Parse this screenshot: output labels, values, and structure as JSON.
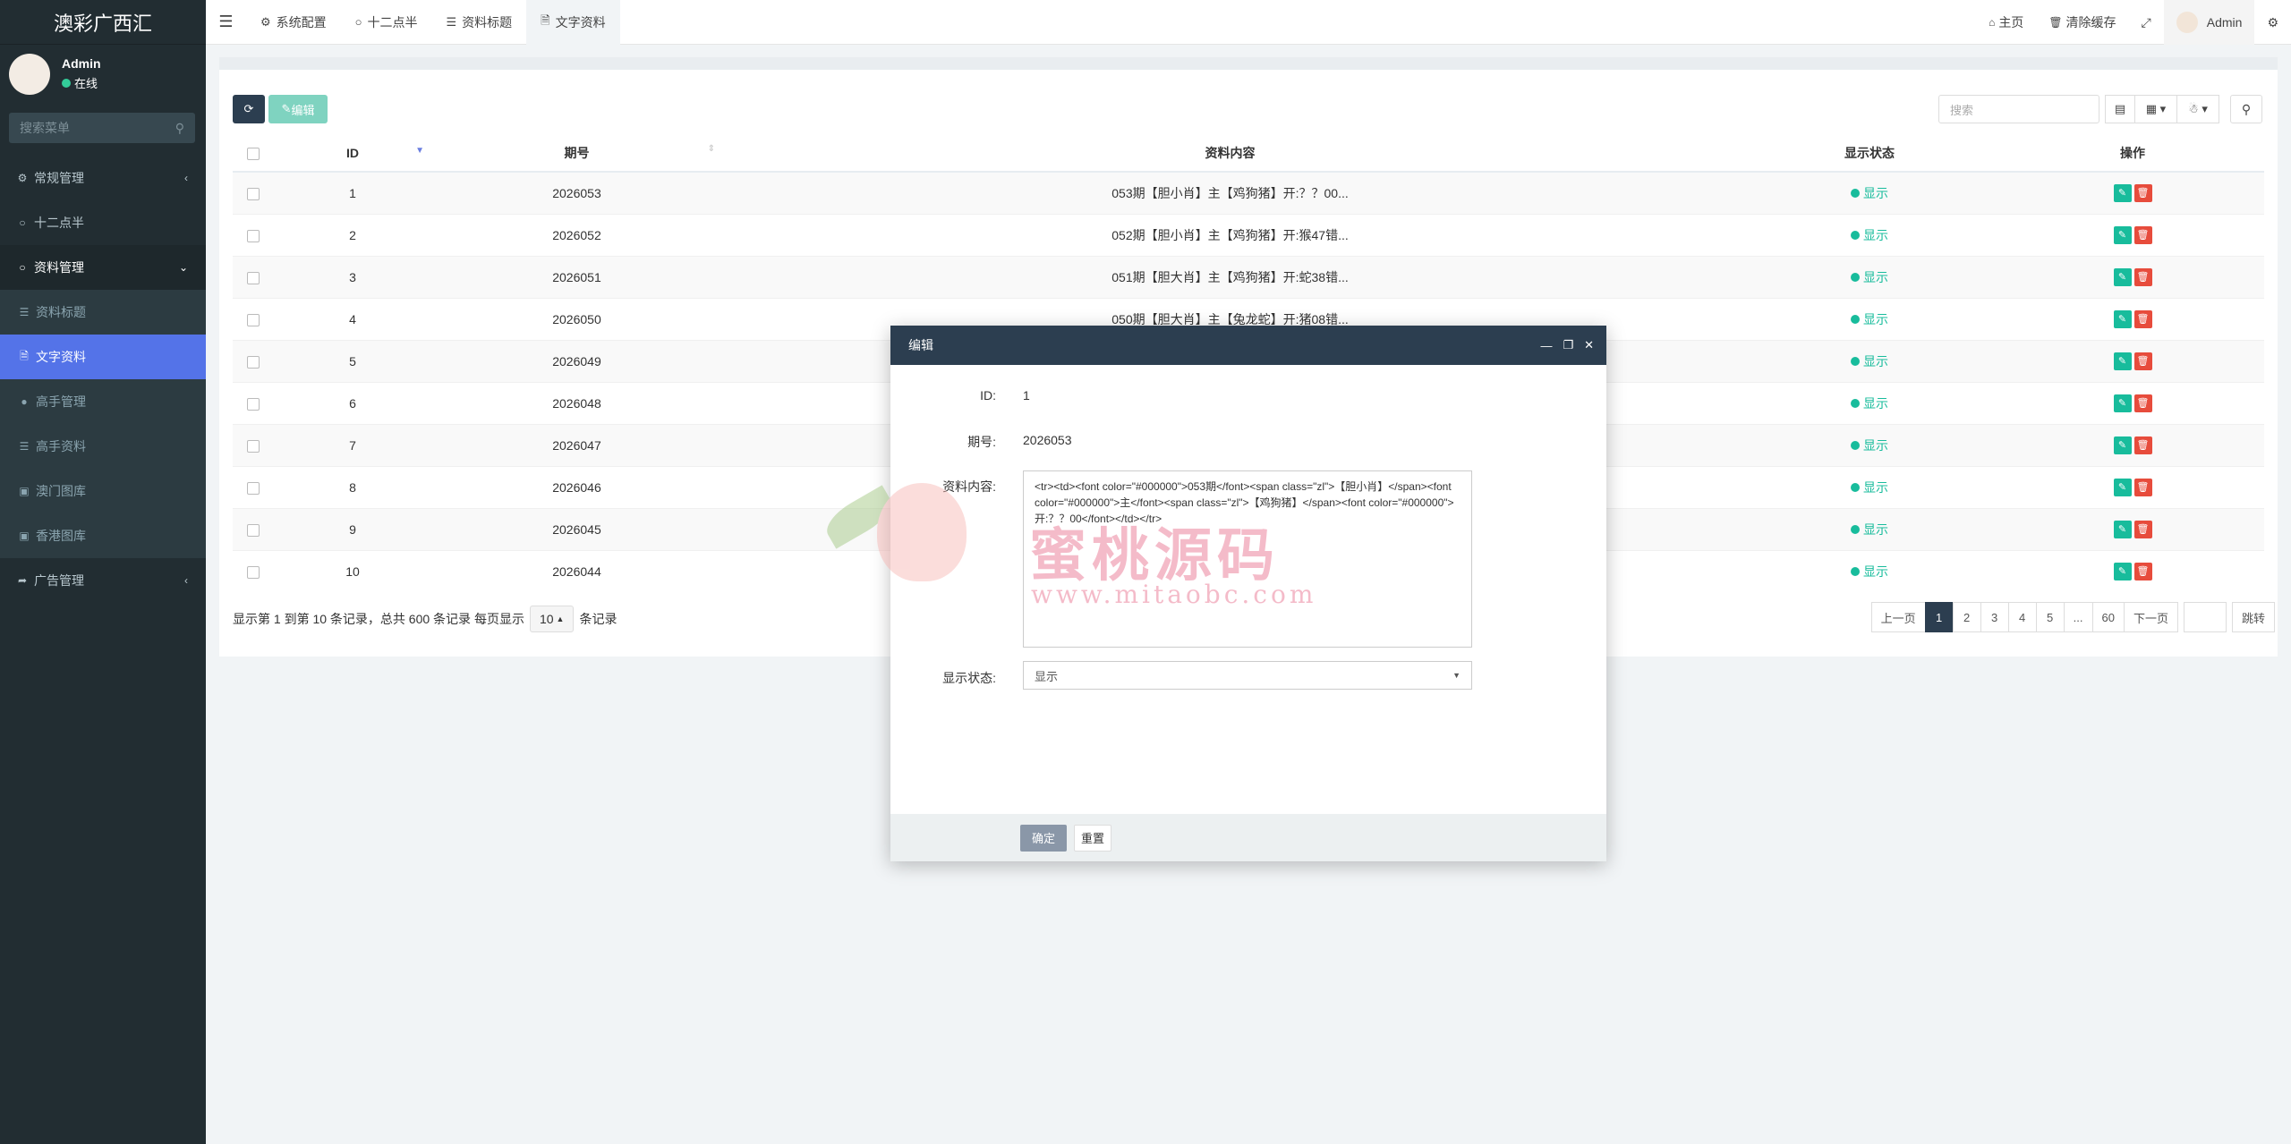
{
  "sidebar": {
    "logo": "澳彩广西汇",
    "user_name": "Admin",
    "user_status": "在线",
    "search_placeholder": "搜索菜单",
    "items": [
      {
        "label": "常规管理",
        "icon": "cogs-icon"
      },
      {
        "label": "十二点半",
        "icon": "circle-icon"
      },
      {
        "label": "资料管理",
        "icon": "circle-icon"
      },
      {
        "label": "资料标题",
        "icon": "list-icon"
      },
      {
        "label": "文字资料",
        "icon": "file-icon"
      },
      {
        "label": "高手管理",
        "icon": "user-icon"
      },
      {
        "label": "高手资料",
        "icon": "list-icon"
      },
      {
        "label": "澳门图库",
        "icon": "image-icon"
      },
      {
        "label": "香港图库",
        "icon": "image-icon"
      },
      {
        "label": "广告管理",
        "icon": "bullhorn-icon"
      }
    ]
  },
  "topbar": {
    "tabs": [
      {
        "label": "系统配置"
      },
      {
        "label": "十二点半"
      },
      {
        "label": "资料标题"
      },
      {
        "label": "文字资料"
      }
    ],
    "home": "主页",
    "clear_cache": "清除缓存",
    "admin": "Admin"
  },
  "toolbar": {
    "edit_label": "编辑",
    "search_placeholder": "搜索"
  },
  "table": {
    "headers": [
      "ID",
      "期号",
      "资料内容",
      "显示状态",
      "操作"
    ],
    "rows": [
      {
        "id": "1",
        "issue": "2026053",
        "content": "053期【胆小肖】主【鸡狗猪】开:？？00...",
        "status": "显示"
      },
      {
        "id": "2",
        "issue": "2026052",
        "content": "052期【胆小肖】主【鸡狗猪】开:猴47错...",
        "status": "显示"
      },
      {
        "id": "3",
        "issue": "2026051",
        "content": "051期【胆大肖】主【鸡狗猪】开:蛇38错...",
        "status": "显示"
      },
      {
        "id": "4",
        "issue": "2026050",
        "content": "050期【胆大肖】主【兔龙蛇】开:猪08错...",
        "status": "显示"
      },
      {
        "id": "5",
        "issue": "2026049",
        "content": "",
        "status": "显示"
      },
      {
        "id": "6",
        "issue": "2026048",
        "content": "",
        "status": "显示"
      },
      {
        "id": "7",
        "issue": "2026047",
        "content": "",
        "status": "显示"
      },
      {
        "id": "8",
        "issue": "2026046",
        "content": "",
        "status": "显示"
      },
      {
        "id": "9",
        "issue": "2026045",
        "content": "",
        "status": "显示"
      },
      {
        "id": "10",
        "issue": "2026044",
        "content": "",
        "status": "显示"
      }
    ]
  },
  "footer": {
    "info_prefix": "显示第 1 到第 10 条记录，总共 600 条记录 每页显示",
    "page_size": "10",
    "info_suffix": "条记录"
  },
  "pager": {
    "prev": "上一页",
    "pages": [
      "1",
      "2",
      "3",
      "4",
      "5",
      "...",
      "60"
    ],
    "next": "下一页",
    "jump": "跳转"
  },
  "watermark": {
    "text": "蜜桃源码",
    "url": "www.mitaobc.com"
  },
  "modal": {
    "title": "编辑",
    "id_label": "ID:",
    "id_value": "1",
    "issue_label": "期号:",
    "issue_value": "2026053",
    "content_label": "资料内容:",
    "content_value": "<tr><td><font color=\"#000000\">053期</font><span class=\"zl\">【胆小肖】</span><font color=\"#000000\">主</font><span class=\"zl\">【鸡狗猪】</span><font color=\"#000000\">开:？？00</font></td></tr>",
    "status_label": "显示状态:",
    "status_value": "显示",
    "ok": "确定",
    "reset": "重置"
  }
}
